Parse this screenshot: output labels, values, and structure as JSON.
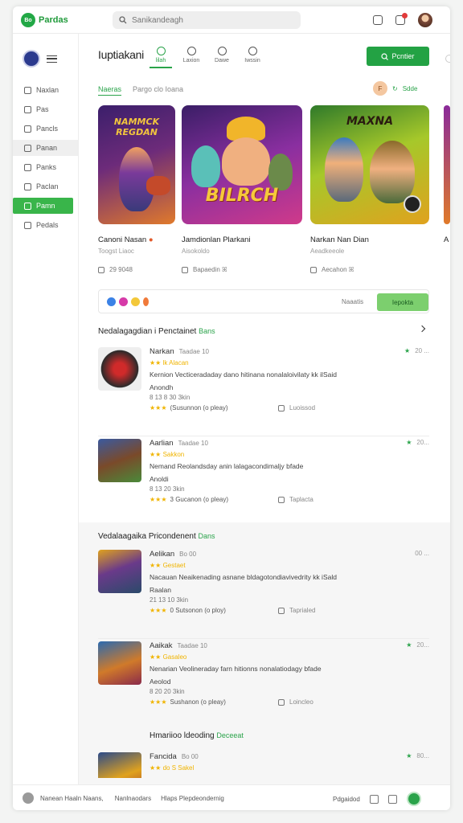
{
  "app": {
    "name": "Pardas",
    "badge": "Bo"
  },
  "search": {
    "placeholder": "Sanikandeagh"
  },
  "sidebar": {
    "items": [
      {
        "label": "Naxlan"
      },
      {
        "label": "Pas"
      },
      {
        "label": "Pancls"
      },
      {
        "label": "Panan"
      },
      {
        "label": "Panks"
      },
      {
        "label": "Paclan"
      },
      {
        "label": "Pamn"
      },
      {
        "label": "Pedals"
      }
    ]
  },
  "header": {
    "title": "Iuptiakani",
    "tabs": [
      {
        "label": "lilah"
      },
      {
        "label": "Laxion"
      },
      {
        "label": "Dawe"
      },
      {
        "label": "Iwssin"
      }
    ],
    "primary_button": "Pcntier"
  },
  "subtabs": {
    "left": "Naeras",
    "right": "Pargo clo Ioana",
    "chip": "F",
    "link": "Sdde"
  },
  "cards": [
    {
      "name": "Canoni Nasan",
      "sub": "Toogst Liaoc",
      "meta": "29  9048",
      "art_title": "NAMMCK REGDAN"
    },
    {
      "name": "Jamdionlan Plarkani",
      "sub": "Aisokoldo",
      "meta": "Bapaedin  ꕤ",
      "art_title": "BILRCH"
    },
    {
      "name": "Narkan Nan Dian",
      "sub": "Aeadkeeole",
      "meta": "Aecahon  ꕤ",
      "art_title": "MAXNA"
    },
    {
      "name": "A",
      "sub": "",
      "meta": ""
    }
  ],
  "share": {
    "label": "Naaatis",
    "button": "Iepokta"
  },
  "section1": {
    "title": "Nedalagagdian i Penctainet",
    "accent": "Bans"
  },
  "section2": {
    "title": "Vedalaagaika Pricondenent",
    "accent": "Dans"
  },
  "section3": {
    "title": "Hmariioo ldeoding",
    "accent": "Deceeat"
  },
  "reviews": [
    {
      "title": "Narkan",
      "version": "Taadae 10",
      "stars": "★★ lk Alacan",
      "text": "Kernion Vecticeradaday dano hitinana nonalaloivilaty kk ilSaid",
      "text2": "Anondh",
      "date": "8 13 8 30 3kin",
      "rating_note": "(Susunnon (o pleay)",
      "action": "Luoissod",
      "right": "20 ..."
    },
    {
      "title": "Aarlian",
      "version": "Taadae 10",
      "stars": "★★ Sakkon",
      "text": "Nemand Reolandsday anin lalagacondimaljy bfade",
      "text2": "Anoldi",
      "date": "8 13 20 3kin",
      "rating_note": "3 Gucanon (o pleay)",
      "action": "Taplacta",
      "right": "20..."
    },
    {
      "title": "Aelikan",
      "version": "Bo 00",
      "stars": "★★ Gestaet",
      "text": "Nacauan Neaikenading asnane bldagotondiavivedrity kk iSald",
      "text2": "Raalan",
      "date": "21 13 10 3kin",
      "rating_note": "0 Sutsonon (o ploy)",
      "action": "Taprialed",
      "right": "00 ..."
    },
    {
      "title": "Aaikak",
      "version": "Taadae 10",
      "stars": "★★ Gasaleo",
      "text": "Nenarian Veolineraday farn hitionns nonalatiodagy bfade",
      "text2": "Aeolod",
      "date": "8 20 20 3kin",
      "rating_note": "Sushanon (o pleay)",
      "action": "Loincleo",
      "right": "20..."
    },
    {
      "title": "Fancida",
      "version": "Bo 00",
      "stars": "★★ do S Sakel",
      "text": "",
      "text2": "",
      "date": "",
      "rating_note": "",
      "action": "",
      "right": "80..."
    }
  ],
  "bottom": {
    "left": "Nanean Haaln Naans,",
    "mid1": "Nanlnaodars",
    "mid2": "Hlaps Plepdeondernig",
    "right": "Pdgaidod"
  }
}
